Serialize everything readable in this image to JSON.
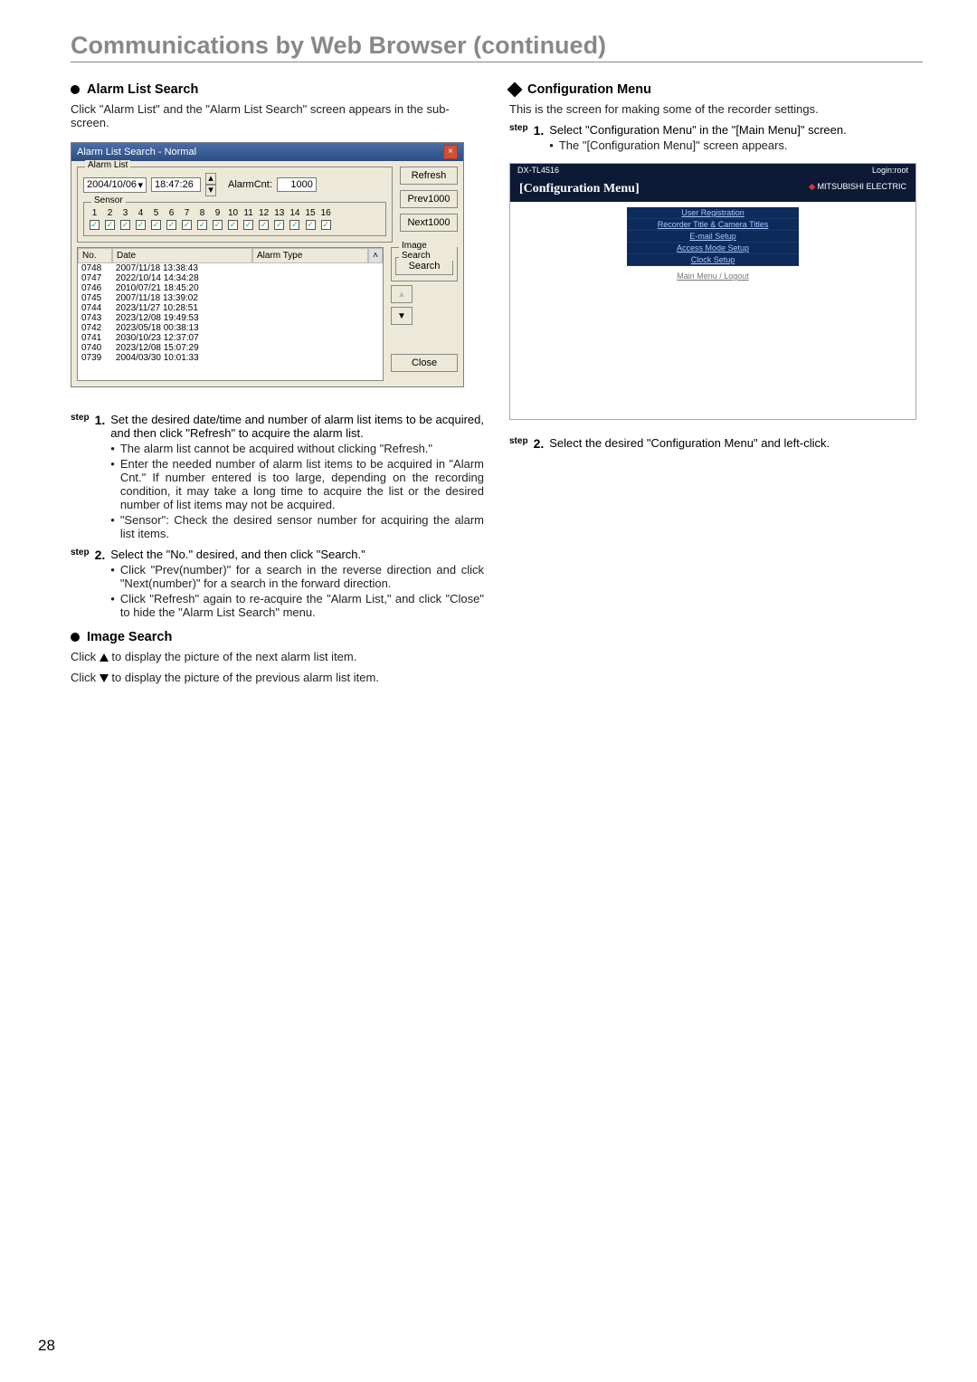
{
  "page_title": "Communications by Web Browser (continued)",
  "page_number": "28",
  "left": {
    "alarm_section_title": "Alarm List Search",
    "alarm_intro": "Click \"Alarm List\" and the \"Alarm List Search\" screen appears in the sub-screen.",
    "win": {
      "title": "Alarm List Search - Normal",
      "fs_alarm": "Alarm List",
      "date_value": "2004/10/06",
      "time_value": "18:47:26",
      "alarmcnt_label": "AlarmCnt:",
      "alarmcnt_value": "1000",
      "refresh": "Refresh",
      "fs_sensor": "Sensor",
      "sensor_nums": [
        "1",
        "2",
        "3",
        "4",
        "5",
        "6",
        "7",
        "8",
        "9",
        "10",
        "11",
        "12",
        "13",
        "14",
        "15",
        "16"
      ],
      "prev": "Prev1000",
      "next": "Next1000",
      "lh_no": "No.",
      "lh_date": "Date",
      "lh_type": "Alarm Type",
      "rows": [
        {
          "no": "0748",
          "date": "2007/11/18 13:38:43"
        },
        {
          "no": "0747",
          "date": "2022/10/14 14:34:28"
        },
        {
          "no": "0746",
          "date": "2010/07/21 18:45:20"
        },
        {
          "no": "0745",
          "date": "2007/11/18 13:39:02"
        },
        {
          "no": "0744",
          "date": "2023/11/27 10:28:51"
        },
        {
          "no": "0743",
          "date": "2023/12/08 19:49:53"
        },
        {
          "no": "0742",
          "date": "2023/05/18 00:38:13"
        },
        {
          "no": "0741",
          "date": "2030/10/23 12:37:07"
        },
        {
          "no": "0740",
          "date": "2023/12/08 15:07:29"
        },
        {
          "no": "0739",
          "date": "2004/03/30 10:01:33"
        }
      ],
      "fs_image": "Image Search",
      "search": "Search",
      "close": "Close"
    },
    "step1_label": "step",
    "step1_num": "1.",
    "step1_text": "Set the desired date/time and number of alarm list items to be acquired, and then click \"Refresh\" to acquire the alarm list.",
    "step1_b1": "The alarm list cannot be acquired without clicking \"Refresh.\"",
    "step1_b2": "Enter the needed number of alarm list items to be acquired in \"Alarm Cnt.\" If number entered is too large, depending on the recording condition, it may take a long time to acquire the list or the desired number of list items may not be acquired.",
    "step1_b3": "\"Sensor\": Check the desired sensor number for acquiring the alarm list items.",
    "step2_label": "step",
    "step2_num": "2.",
    "step2_text": "Select the \"No.\" desired, and then click \"Search.\"",
    "step2_b1": "Click \"Prev(number)\" for a search in the reverse direction and click \"Next(number)\" for a search in the forward direction.",
    "step2_b2": "Click \"Refresh\" again to re-acquire the \"Alarm List,\" and click \"Close\" to hide the \"Alarm List Search\" menu.",
    "image_search_title": "Image Search",
    "img_up_text_pre": "Click ",
    "img_up_text_post": " to display the picture of the next alarm list item.",
    "img_dn_text_pre": "Click ",
    "img_dn_text_post": " to display the picture of the previous alarm list item."
  },
  "right": {
    "cfg_section_title": "Configuration Menu",
    "cfg_intro": "This is the screen for making some of the recorder settings.",
    "step1_label": "step",
    "step1_num": "1.",
    "step1_text": "Select \"Configuration Menu\" in the \"[Main Menu]\" screen.",
    "step1_b1": "The \"[Configuration Menu]\" screen appears.",
    "win": {
      "model": "DX-TL4516",
      "login": "Login:root",
      "brand": "MITSUBISHI ELECTRIC",
      "title": "[Configuration Menu]",
      "items": [
        "User Registration",
        "Recorder Title & Camera Titles",
        "E-mail Setup",
        "Access Mode Setup",
        "Clock Setup"
      ],
      "mainmenu": "Main Menu / Logout"
    },
    "step2_label": "step",
    "step2_num": "2.",
    "step2_text": "Select the desired \"Configuration Menu\" and left-click."
  }
}
